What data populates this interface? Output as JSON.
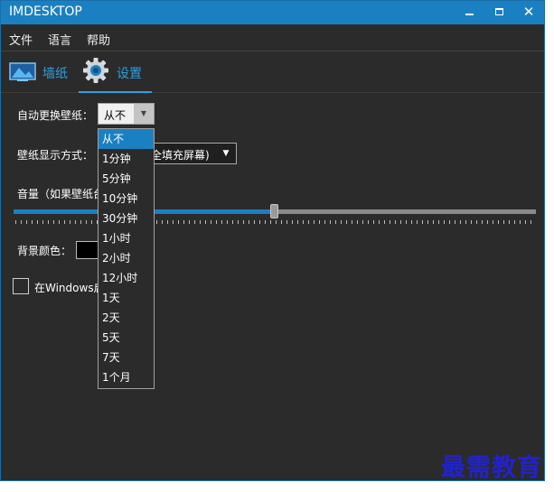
{
  "window": {
    "title": "IMDESKTOP"
  },
  "menu": [
    "文件",
    "语言",
    "帮助"
  ],
  "tabs": [
    {
      "label": "墙纸",
      "icon": "wallpaper-icon",
      "active": false
    },
    {
      "label": "设置",
      "icon": "gear-icon",
      "active": true
    }
  ],
  "settings": {
    "auto_change_label": "自动更换壁纸：",
    "auto_change_value": "从不",
    "display_mode_label": "壁纸显示方式：",
    "display_mode_value": "全填充屏幕)",
    "volume_label": "音量（如果壁纸台",
    "volume_level": 0.5,
    "bg_color_label": "背景颜色：",
    "bg_color": "#000000",
    "startup_label": "在Windows启",
    "startup_checked": false
  },
  "dropdown_options": [
    "从不",
    "1分钟",
    "5分钟",
    "10分钟",
    "30分钟",
    "1小时",
    "2小时",
    "12小时",
    "1天",
    "2天",
    "5天",
    "7天",
    "1个月"
  ],
  "selected_index": 0,
  "watermark": "最需教育",
  "colors": {
    "accent": "#1b80c1",
    "background": "#2b2b2b",
    "tab_text": "#2f9ee0"
  }
}
